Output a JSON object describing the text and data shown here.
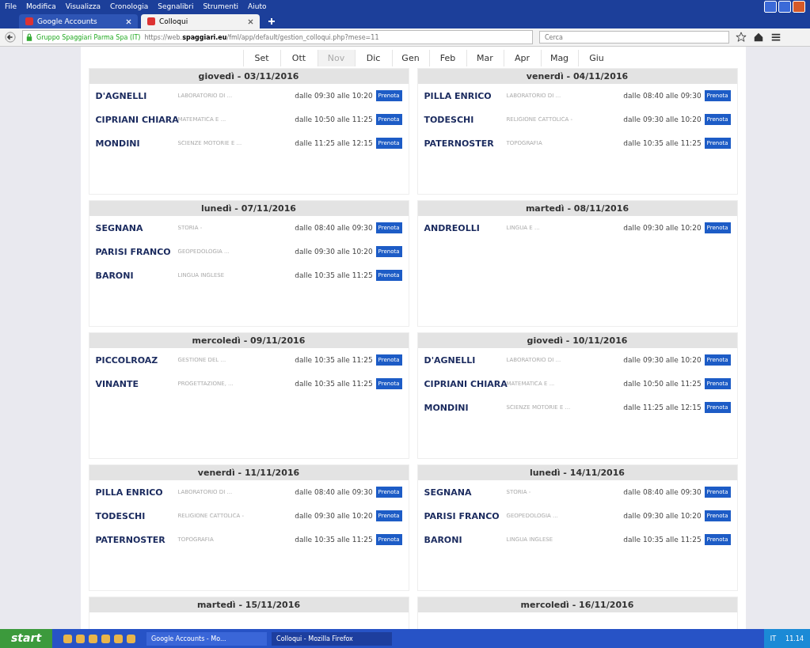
{
  "menu": [
    "File",
    "Modifica",
    "Visualizza",
    "Cronologia",
    "Segnalibri",
    "Strumenti",
    "Aiuto"
  ],
  "tabs": [
    {
      "label": "Google Accounts",
      "selected": false
    },
    {
      "label": "Colloqui",
      "selected": true
    }
  ],
  "address": {
    "site": "Gruppo Spaggiari Parma Spa (IT)",
    "url_prefix": "https://web.",
    "url_domain": "spaggiari.eu",
    "url_path": "/fml/app/default/gestion_colloqui.php?mese=11"
  },
  "search": {
    "placeholder": "Cerca"
  },
  "months": [
    {
      "label": "Set",
      "selected": false
    },
    {
      "label": "Ott",
      "selected": false
    },
    {
      "label": "Nov",
      "selected": true
    },
    {
      "label": "Dic",
      "selected": false
    },
    {
      "label": "Gen",
      "selected": false
    },
    {
      "label": "Feb",
      "selected": false
    },
    {
      "label": "Mar",
      "selected": false
    },
    {
      "label": "Apr",
      "selected": false
    },
    {
      "label": "Mag",
      "selected": false
    },
    {
      "label": "Giu",
      "selected": false
    }
  ],
  "days": [
    {
      "date": "giovedì - 03/11/2016",
      "rows": [
        {
          "teacher": "D'AGNELLI",
          "subject": "LABORATORIO DI ...",
          "time": "dalle 09:30 alle 10:20",
          "button": "Prenota"
        },
        {
          "teacher": "CIPRIANI CHIARA",
          "subject": "MATEMATICA E ...",
          "time": "dalle 10:50 alle 11:25",
          "button": "Prenota"
        },
        {
          "teacher": "MONDINI",
          "subject": "SCIENZE MOTORIE E ...",
          "time": "dalle 11:25 alle 12:15",
          "button": "Prenota"
        }
      ]
    },
    {
      "date": "venerdì - 04/11/2016",
      "rows": [
        {
          "teacher": "PILLA ENRICO",
          "subject": "LABORATORIO DI ...",
          "time": "dalle 08:40 alle 09:30",
          "button": "Prenota"
        },
        {
          "teacher": "TODESCHI",
          "subject": "RELIGIONE CATTOLICA -",
          "time": "dalle 09:30 alle 10:20",
          "button": "Prenota"
        },
        {
          "teacher": "PATERNOSTER",
          "subject": "TOPOGRAFIA",
          "time": "dalle 10:35 alle 11:25",
          "button": "Prenota"
        }
      ]
    },
    {
      "date": "lunedì - 07/11/2016",
      "rows": [
        {
          "teacher": "SEGNANA",
          "subject": "STORIA -",
          "time": "dalle 08:40 alle 09:30",
          "button": "Prenota"
        },
        {
          "teacher": "PARISI FRANCO",
          "subject": "GEOPEDOLOGIA ...",
          "time": "dalle 09:30 alle 10:20",
          "button": "Prenota"
        },
        {
          "teacher": "BARONI",
          "subject": "LINGUA INGLESE",
          "time": "dalle 10:35 alle 11:25",
          "button": "Prenota"
        }
      ]
    },
    {
      "date": "martedì - 08/11/2016",
      "rows": [
        {
          "teacher": "ANDREOLLI",
          "subject": "LINGUA E ...",
          "time": "dalle 09:30 alle 10:20",
          "button": "Prenota"
        }
      ]
    },
    {
      "date": "mercoledì - 09/11/2016",
      "rows": [
        {
          "teacher": "PICCOLROAZ",
          "subject": "GESTIONE DEL ...",
          "time": "dalle 10:35 alle 11:25",
          "button": "Prenota"
        },
        {
          "teacher": "VINANTE",
          "subject": "PROGETTAZIONE, ...",
          "time": "dalle 10:35 alle 11:25",
          "button": "Prenota"
        }
      ]
    },
    {
      "date": "giovedì - 10/11/2016",
      "rows": [
        {
          "teacher": "D'AGNELLI",
          "subject": "LABORATORIO DI ...",
          "time": "dalle 09:30 alle 10:20",
          "button": "Prenota"
        },
        {
          "teacher": "CIPRIANI CHIARA",
          "subject": "MATEMATICA E ...",
          "time": "dalle 10:50 alle 11:25",
          "button": "Prenota"
        },
        {
          "teacher": "MONDINI",
          "subject": "SCIENZE MOTORIE E ...",
          "time": "dalle 11:25 alle 12:15",
          "button": "Prenota"
        }
      ]
    },
    {
      "date": "venerdì - 11/11/2016",
      "rows": [
        {
          "teacher": "PILLA ENRICO",
          "subject": "LABORATORIO DI ...",
          "time": "dalle 08:40 alle 09:30",
          "button": "Prenota"
        },
        {
          "teacher": "TODESCHI",
          "subject": "RELIGIONE CATTOLICA -",
          "time": "dalle 09:30 alle 10:20",
          "button": "Prenota"
        },
        {
          "teacher": "PATERNOSTER",
          "subject": "TOPOGRAFIA",
          "time": "dalle 10:35 alle 11:25",
          "button": "Prenota"
        }
      ]
    },
    {
      "date": "lunedì - 14/11/2016",
      "rows": [
        {
          "teacher": "SEGNANA",
          "subject": "STORIA -",
          "time": "dalle 08:40 alle 09:30",
          "button": "Prenota"
        },
        {
          "teacher": "PARISI FRANCO",
          "subject": "GEOPEDOLOGIA ...",
          "time": "dalle 09:30 alle 10:20",
          "button": "Prenota"
        },
        {
          "teacher": "BARONI",
          "subject": "LINGUA INGLESE",
          "time": "dalle 10:35 alle 11:25",
          "button": "Prenota"
        }
      ]
    },
    {
      "date": "martedì - 15/11/2016"
    },
    {
      "date": "mercoledì - 16/11/2016"
    }
  ],
  "taskbar": {
    "start": "start",
    "tasks": [
      {
        "label": "Google Accounts - Mo...",
        "selected": false
      },
      {
        "label": "Colloqui - Mozilla Firefox",
        "selected": true
      }
    ],
    "lang": "IT",
    "clock": "11.14"
  }
}
